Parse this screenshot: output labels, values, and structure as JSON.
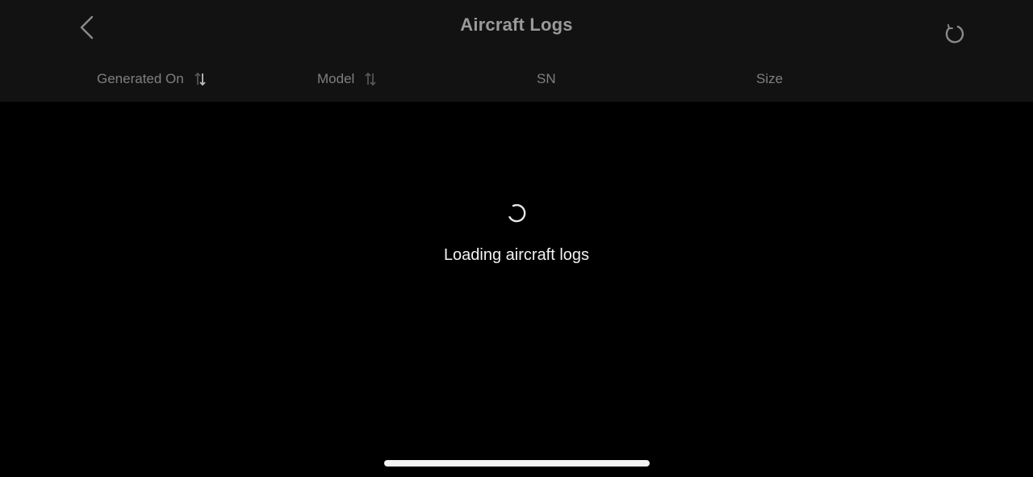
{
  "header": {
    "title": "Aircraft Logs",
    "back_icon": "chevron-left-icon",
    "refresh_icon": "refresh-icon"
  },
  "columns": [
    {
      "label": "Generated On",
      "sortable": true,
      "sort_icon": "sort-desc-icon"
    },
    {
      "label": "Model",
      "sortable": true,
      "sort_icon": "sort-icon"
    },
    {
      "label": "SN",
      "sortable": false
    },
    {
      "label": "Size",
      "sortable": false
    }
  ],
  "status": {
    "loading_text": "Loading aircraft logs",
    "spinner_icon": "loading-spinner-icon"
  },
  "colors": {
    "background": "#000000",
    "header_background": "#121212",
    "title": "#9a9a9a",
    "column_label": "#7f7f7f",
    "loading_text": "#f2f2f2",
    "home_indicator": "#f5f5f5"
  }
}
